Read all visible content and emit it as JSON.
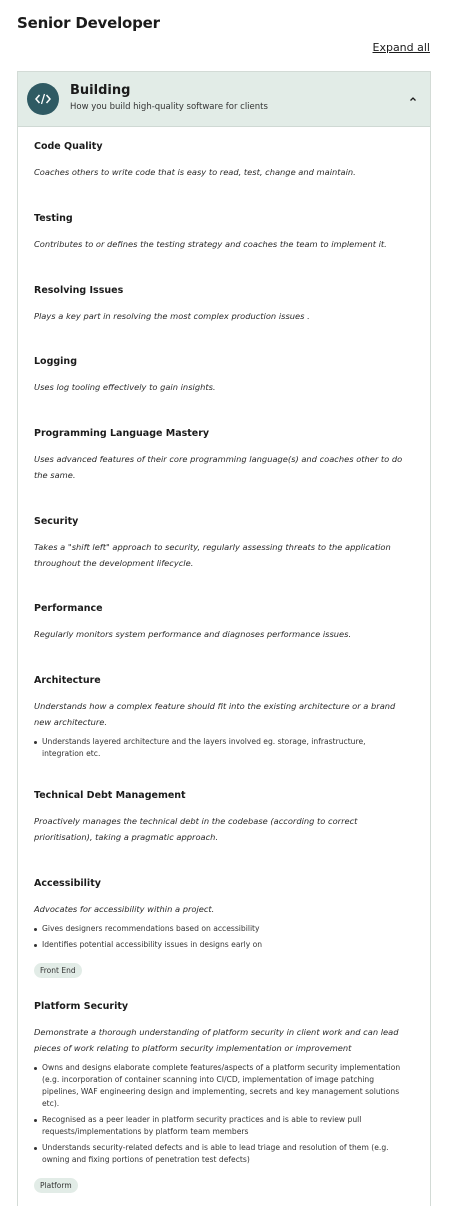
{
  "page": {
    "title": "Senior Developer",
    "expand_all": "Expand all"
  },
  "section": {
    "title": "Building",
    "subtitle": "How you build high-quality software for clients",
    "icon": "code-icon",
    "accent": "#2f5a63",
    "header_bg": "#e2ece7"
  },
  "skills": [
    {
      "title": "Code Quality",
      "desc": "Coaches others to write code that is easy to read, test, change and maintain."
    },
    {
      "title": "Testing",
      "desc": "Contributes to or defines the testing strategy and coaches the team to implement it."
    },
    {
      "title": "Resolving Issues",
      "desc": "Plays a key part in resolving the most complex production issues ."
    },
    {
      "title": "Logging",
      "desc": "Uses log tooling effectively to gain insights."
    },
    {
      "title": "Programming Language Mastery",
      "desc": "Uses advanced features of their core programming language(s) and coaches other to do the same."
    },
    {
      "title": "Security",
      "desc": "Takes a \"shift left\" approach to security, regularly assessing threats to the application throughout the development lifecycle."
    },
    {
      "title": "Performance",
      "desc": "Regularly monitors system performance and diagnoses performance issues."
    },
    {
      "title": "Architecture",
      "desc": "Understands how a complex feature should fit into the existing architecture or a brand new architecture.",
      "bullets": [
        "Understands layered architecture and the layers involved eg. storage, infrastructure, integration etc."
      ]
    },
    {
      "title": "Technical Debt Management",
      "desc": "Proactively manages the technical debt in the codebase (according to correct prioritisation), taking a pragmatic approach."
    },
    {
      "title": "Accessibility",
      "desc": "Advocates for accessibility within a project.",
      "bullets": [
        "Gives designers recommendations based on accessibility",
        "Identifies potential accessibility issues in designs early on"
      ],
      "tag": "Front End"
    },
    {
      "title": "Platform Security",
      "desc": "Demonstrate a thorough understanding of platform security in client work and can lead pieces of work relating to platform security implementation or improvement",
      "bullets": [
        "Owns and designs elaborate complete features/aspects of a platform security implementation (e.g. incorporation of container scanning into CI/CD, implementation of image patching pipelines, WAF engineering design and implementing, secrets and key management solutions etc).",
        "Recognised as a peer leader in platform security practices and is able to review pull requests/implementations by platform team members",
        "Understands security-related defects and is able to lead triage and resolution of them (e.g. owning and fixing portions of penetration test defects)"
      ],
      "tag": "Platform"
    }
  ]
}
